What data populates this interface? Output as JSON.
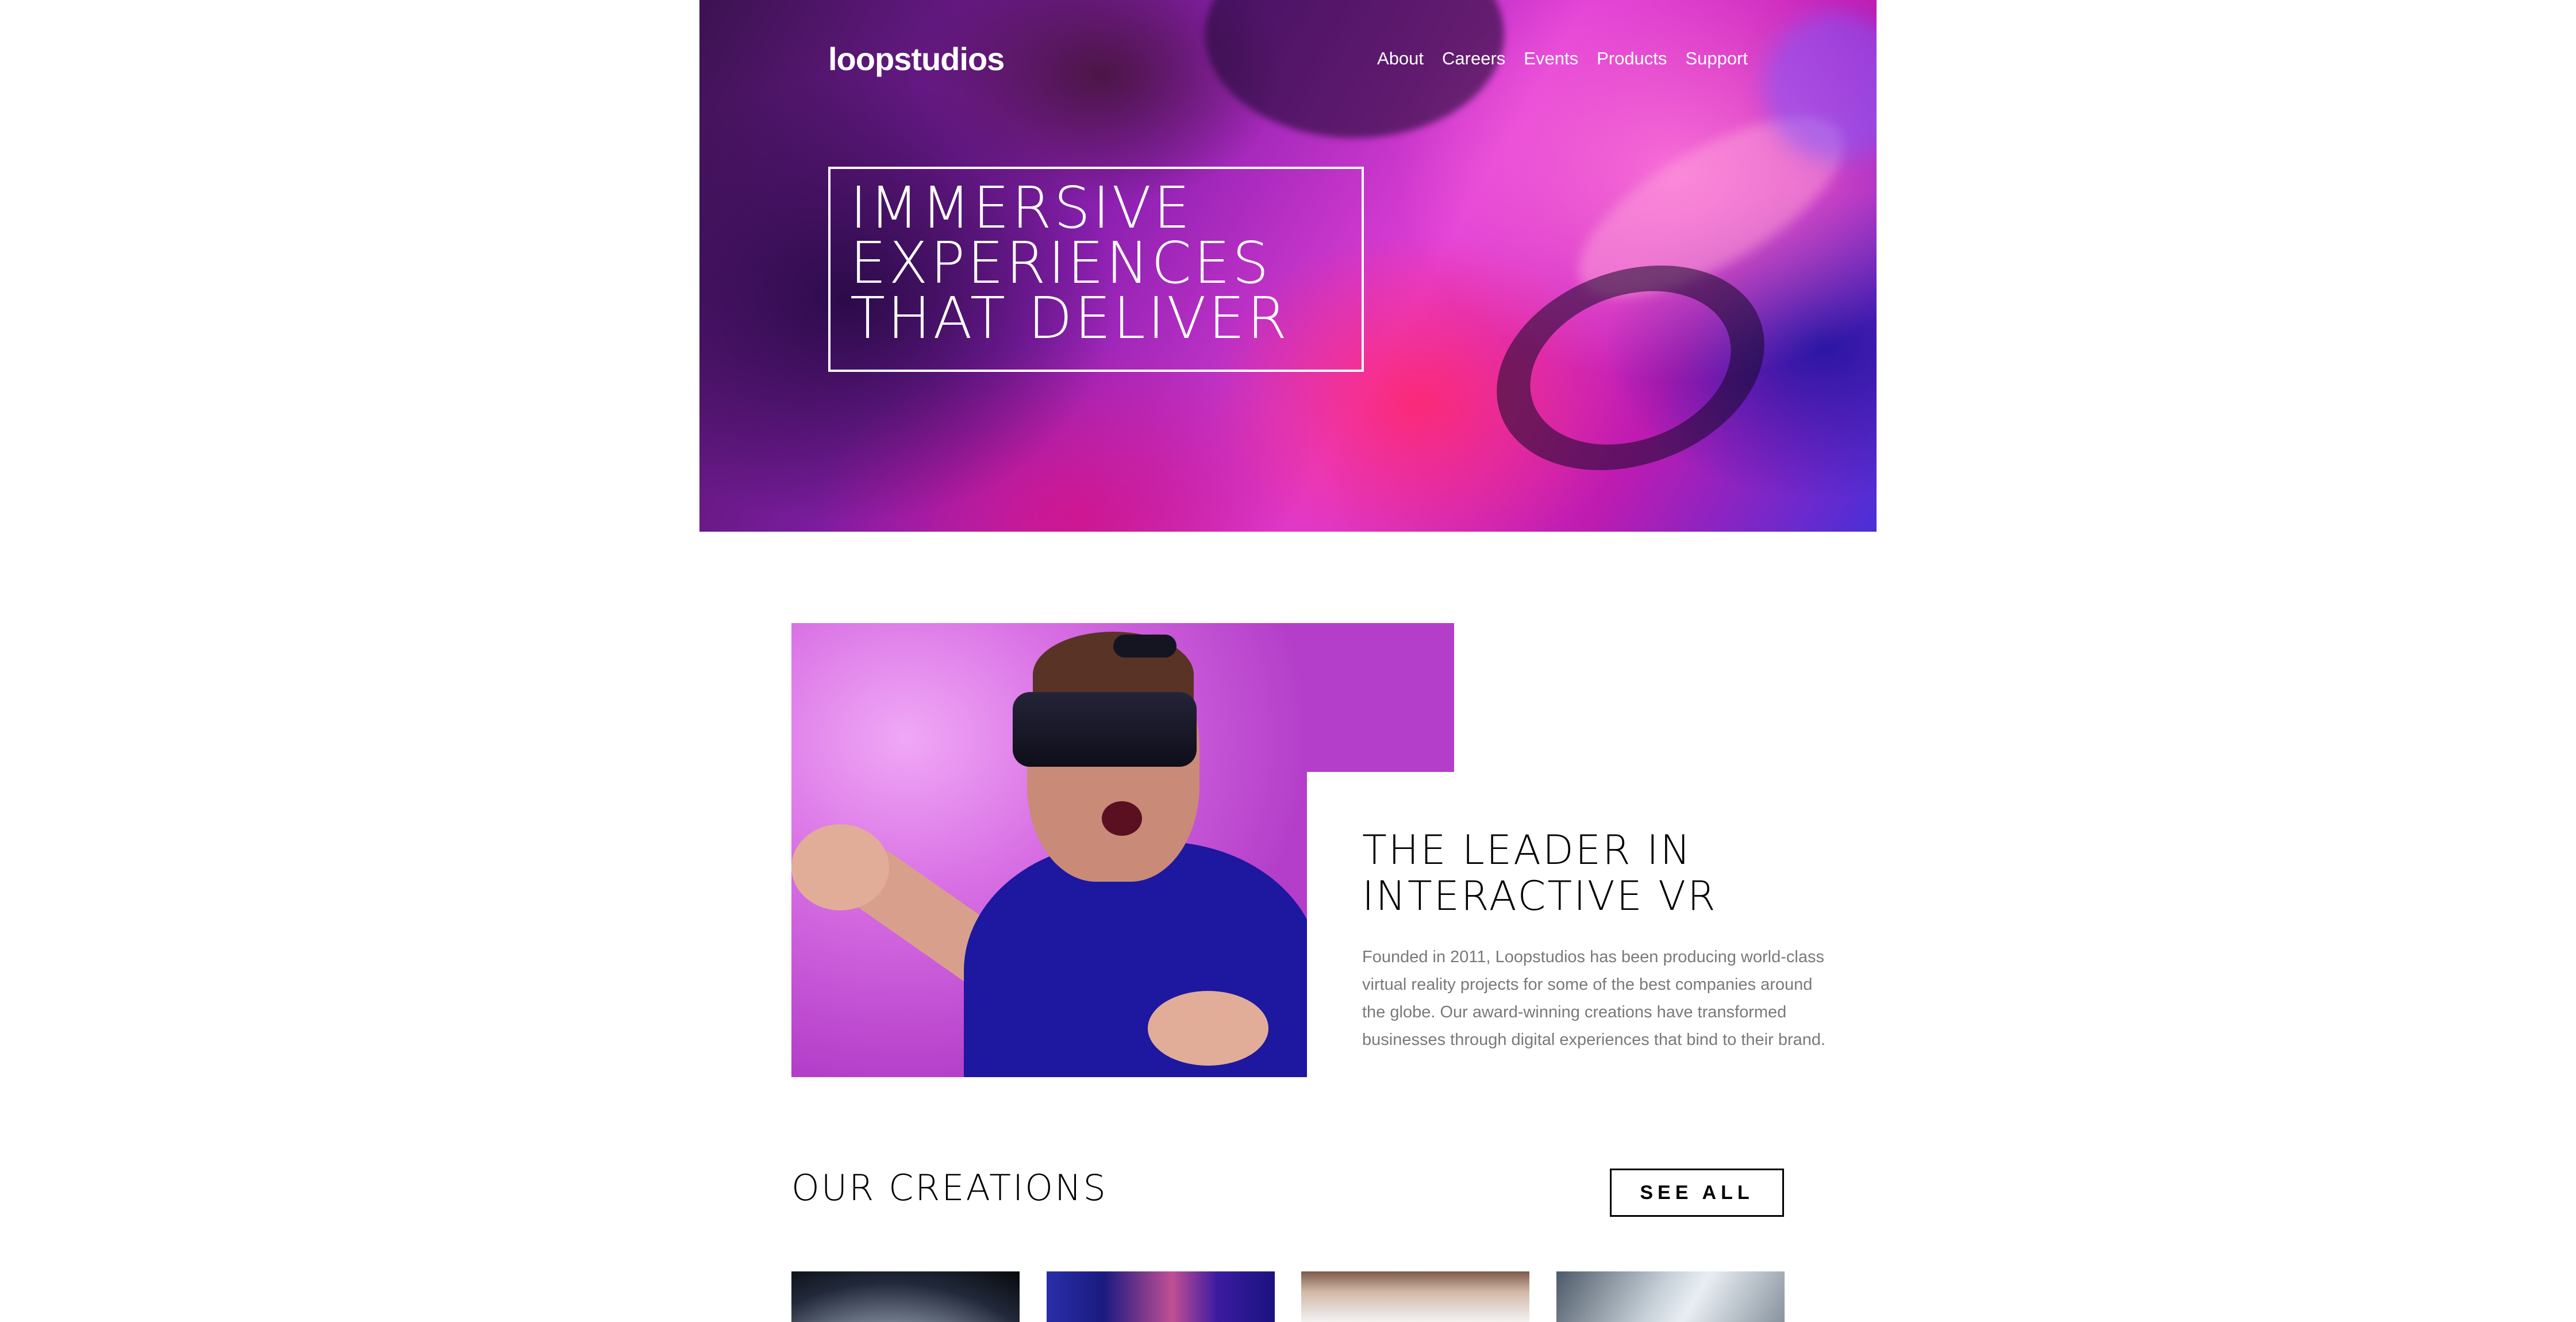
{
  "header": {
    "logo": "loopstudios",
    "nav": [
      "About",
      "Careers",
      "Events",
      "Products",
      "Support"
    ]
  },
  "hero": {
    "title": "IMMERSIVE\nEXPERIENCES\nTHAT DELIVER"
  },
  "intro": {
    "title": "THE LEADER IN\nINTERACTIVE VR",
    "text": "Founded in 2011, Loopstudios has been producing world-class virtual reality projects for some of the best companies around the globe. Our award-winning creations have transformed businesses through digital experiences that bind to their brand."
  },
  "creations": {
    "title": "OUR CREATIONS",
    "see_all": "SEE ALL"
  },
  "colors": {
    "accent_text": "#797979",
    "hero_magenta": "#e23fd6",
    "vr_shirt": "#1e17a0"
  }
}
